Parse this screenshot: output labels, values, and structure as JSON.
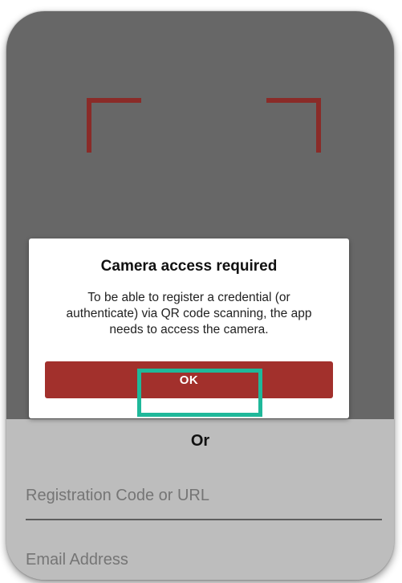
{
  "colors": {
    "camera_background": "#676767",
    "lower_background": "#bdbdbd",
    "scan_frame": "#8a2b28",
    "button": "#a2302c",
    "highlight": "#1fb89a"
  },
  "scanner": {
    "frame_icon": "scan-frame-corner-icon"
  },
  "dialog": {
    "title": "Camera access required",
    "message": "To be able to register a credential (or authenticate) via QR code scanning, the app needs to access the camera.",
    "ok_label": "OK"
  },
  "form": {
    "or_label": "Or",
    "registration_placeholder": "Registration Code or URL",
    "email_placeholder": "Email Address"
  }
}
